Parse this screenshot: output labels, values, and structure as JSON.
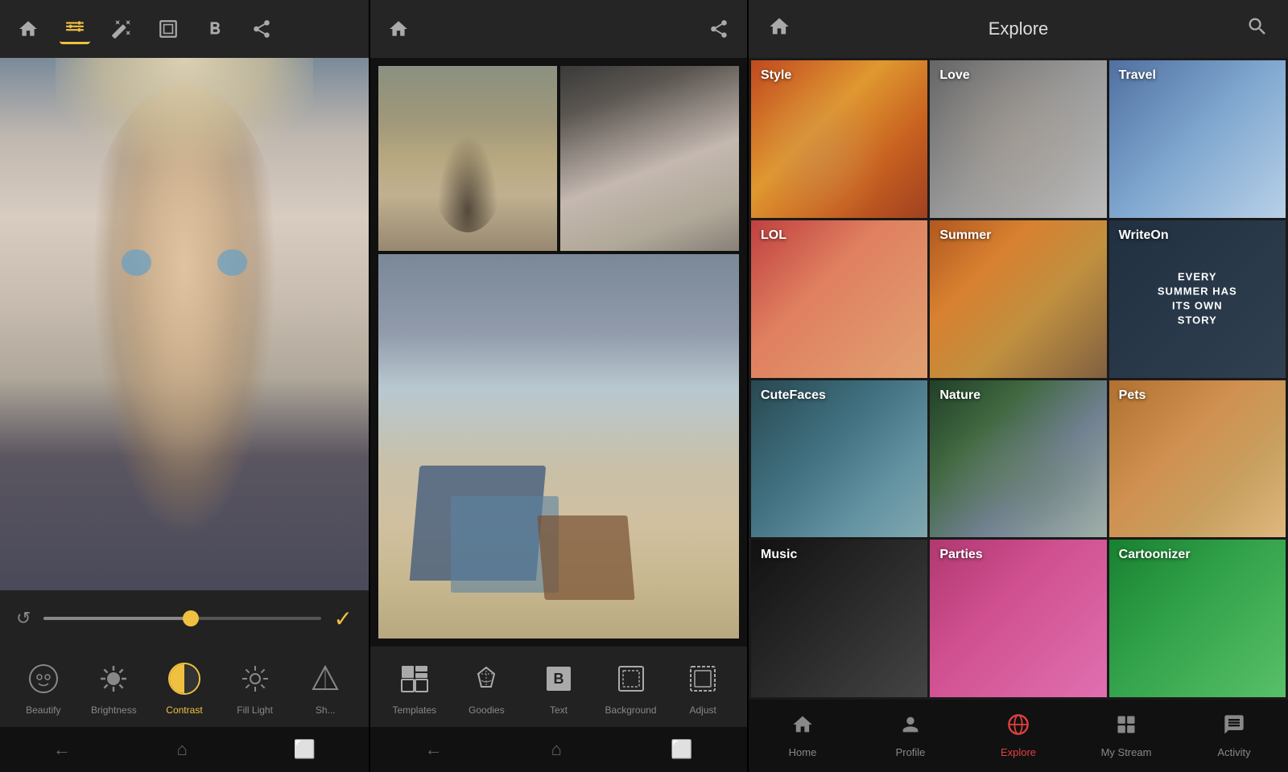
{
  "panel1": {
    "toolbar": {
      "home_label": "Home",
      "tune_label": "Tune",
      "magic_label": "Magic",
      "frame_label": "Frame",
      "bold_label": "Bold",
      "share_label": "Share"
    },
    "tools": [
      {
        "id": "beautify",
        "label": "Beautify",
        "active": false
      },
      {
        "id": "brightness",
        "label": "Brightness",
        "active": false
      },
      {
        "id": "contrast",
        "label": "Contrast",
        "active": true
      },
      {
        "id": "fill_light",
        "label": "Fill Light",
        "active": false
      },
      {
        "id": "sharpen",
        "label": "Sh...",
        "active": false
      }
    ],
    "nav": [
      "back",
      "home",
      "recent"
    ]
  },
  "panel2": {
    "toolbar": {
      "home_label": "Home",
      "share_label": "Share"
    },
    "bottom_tools": [
      {
        "id": "templates",
        "label": "Templates"
      },
      {
        "id": "goodies",
        "label": "Goodies"
      },
      {
        "id": "text",
        "label": "Text"
      },
      {
        "id": "background",
        "label": "Background"
      },
      {
        "id": "adjust",
        "label": "Adjust"
      }
    ],
    "nav": [
      "back",
      "home",
      "recent"
    ]
  },
  "panel3": {
    "header": {
      "title": "Explore"
    },
    "categories": [
      {
        "id": "style",
        "label": "Style",
        "bg_class": "bg-style"
      },
      {
        "id": "love",
        "label": "Love",
        "bg_class": "bg-love"
      },
      {
        "id": "travel",
        "label": "Travel",
        "bg_class": "bg-travel"
      },
      {
        "id": "lol",
        "label": "LOL",
        "bg_class": "bg-lol"
      },
      {
        "id": "summer",
        "label": "Summer",
        "bg_class": "bg-summer"
      },
      {
        "id": "writeon",
        "label": "WriteOn",
        "bg_class": "bg-writeon"
      },
      {
        "id": "cutefaces",
        "label": "CuteFaces",
        "bg_class": "bg-cutefaces"
      },
      {
        "id": "nature",
        "label": "Nature",
        "bg_class": "bg-nature"
      },
      {
        "id": "pets",
        "label": "Pets",
        "bg_class": "bg-pets"
      },
      {
        "id": "music",
        "label": "Music",
        "bg_class": "bg-music"
      },
      {
        "id": "parties",
        "label": "Parties",
        "bg_class": "bg-parties"
      },
      {
        "id": "cartoonizer",
        "label": "Cartoonizer",
        "bg_class": "bg-cartoonizer"
      }
    ],
    "writeon_text": "EVERY SUMMER HAS ITS OWN STORY",
    "nav": [
      {
        "id": "home",
        "label": "Home",
        "active": false
      },
      {
        "id": "profile",
        "label": "Profile",
        "active": false
      },
      {
        "id": "explore",
        "label": "Explore",
        "active": true
      },
      {
        "id": "mystream",
        "label": "My Stream",
        "active": false
      },
      {
        "id": "activity",
        "label": "Activity",
        "active": false
      }
    ]
  }
}
